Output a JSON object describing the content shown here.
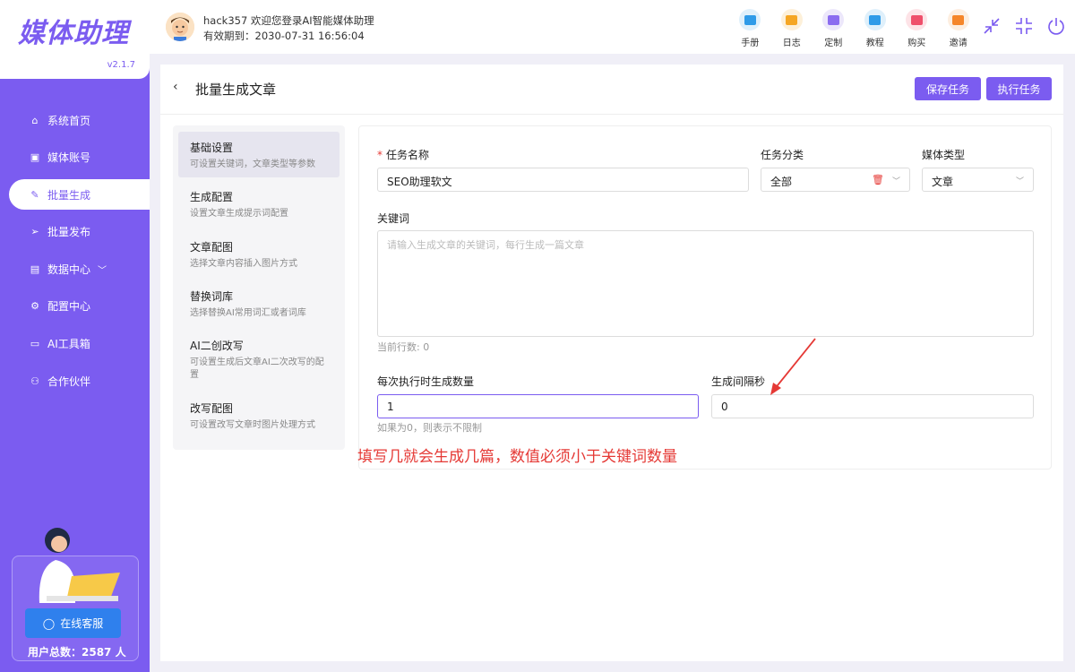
{
  "sidebar": {
    "logo": "媒体助理",
    "version": "v2.1.7",
    "items": [
      {
        "label": "系统首页",
        "icon": "home-icon"
      },
      {
        "label": "媒体账号",
        "icon": "account-icon"
      },
      {
        "label": "批量生成",
        "icon": "edit-icon"
      },
      {
        "label": "批量发布",
        "icon": "send-icon"
      },
      {
        "label": "数据中心",
        "icon": "data-icon"
      },
      {
        "label": "配置中心",
        "icon": "settings-icon"
      },
      {
        "label": "AI工具箱",
        "icon": "toolbox-icon"
      },
      {
        "label": "合作伙伴",
        "icon": "partner-icon"
      }
    ],
    "support_label": "在线客服",
    "user_total": "用户总数：2587 人"
  },
  "header": {
    "welcome": "hack357 欢迎您登录AI智能媒体助理",
    "expiry": "有效期到：2030-07-31 16:56:04",
    "tools": [
      {
        "label": "手册",
        "icon": "manual-icon",
        "bg": "#dff0fb",
        "color": "#2f9be8"
      },
      {
        "label": "日志",
        "icon": "log-icon",
        "bg": "#fdf0d9",
        "color": "#f5a623"
      },
      {
        "label": "定制",
        "icon": "custom-icon",
        "bg": "#ece7fb",
        "color": "#8b6cf0"
      },
      {
        "label": "教程",
        "icon": "tutorial-icon",
        "bg": "#dff0fb",
        "color": "#2f9be8"
      },
      {
        "label": "购买",
        "icon": "buy-icon",
        "bg": "#fde3e7",
        "color": "#ef4f6b"
      },
      {
        "label": "邀请",
        "icon": "invite-icon",
        "bg": "#fdeee0",
        "color": "#f5862a"
      }
    ]
  },
  "main": {
    "title": "批量生成文章",
    "save_label": "保存任务",
    "run_label": "执行任务",
    "steps": [
      {
        "title": "基础设置",
        "desc": "可设置关键词，文章类型等参数"
      },
      {
        "title": "生成配置",
        "desc": "设置文章生成提示词配置"
      },
      {
        "title": "文章配图",
        "desc": "选择文章内容插入图片方式"
      },
      {
        "title": "替换词库",
        "desc": "选择替换AI常用词汇或者词库"
      },
      {
        "title": "AI二创改写",
        "desc": "可设置生成后文章AI二次改写的配置"
      },
      {
        "title": "改写配图",
        "desc": "可设置改写文章时图片处理方式"
      }
    ],
    "form": {
      "task_name_label": "任务名称",
      "task_name_value": "SEO助理软文",
      "category_label": "任务分类",
      "category_value": "全部",
      "media_type_label": "媒体类型",
      "media_type_value": "文章",
      "keywords_label": "关键词",
      "keywords_placeholder": "请输入生成文章的关键词，每行生成一篇文章",
      "line_count": "当前行数: 0",
      "per_run_label": "每次执行时生成数量",
      "per_run_value": "1",
      "per_run_hint": "如果为0，则表示不限制",
      "interval_label": "生成间隔秒",
      "interval_value": "0"
    }
  },
  "annotation": "填写几就会生成几篇，数值必须小于关键词数量"
}
